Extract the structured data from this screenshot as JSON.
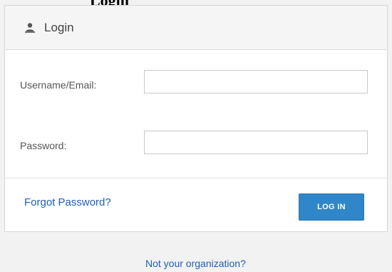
{
  "heading": {
    "text": "Login"
  },
  "panel": {
    "title": "Login",
    "icon": "user-icon"
  },
  "form": {
    "username_label": "Username/Email:",
    "username_value": "",
    "password_label": "Password:",
    "password_value": ""
  },
  "footer": {
    "forgot_link": "Forgot Password?",
    "login_button": "LOG IN"
  },
  "bottom": {
    "not_org_link": "Not your organization?"
  },
  "colors": {
    "accent": "#2f86c9",
    "link": "#1f5eb8",
    "background": "#f2f2f2"
  }
}
